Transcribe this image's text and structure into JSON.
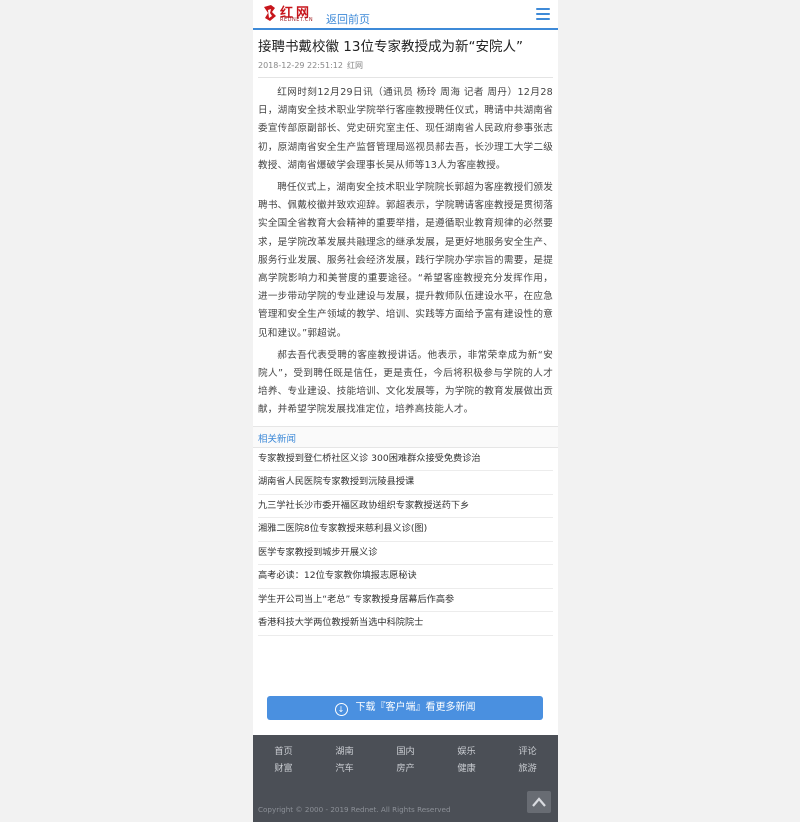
{
  "header": {
    "logo_text": "红网",
    "logo_sub": "REDNET.CN",
    "back_label": "返回前页"
  },
  "article": {
    "title": "接聘书戴校徽 13位专家教授成为新“安院人”",
    "date": "2018-12-29 22:51:12",
    "source": "红网",
    "paragraphs": [
      "红网时刻12月29日讯（通讯员 杨玲 周海 记者 周丹）12月28日，湖南安全技术职业学院举行客座教授聘任仪式，聘请中共湖南省委宣传部原副部长、党史研究室主任、现任湖南省人民政府参事张志初，原湖南省安全生产监督管理局巡视员郝去吾，长沙理工大学二级教授、湖南省爆破学会理事长吴从师等13人为客座教授。",
      "聘任仪式上，湖南安全技术职业学院院长郭超为客座教授们颁发聘书、佩戴校徽并致欢迎辞。郭超表示，学院聘请客座教授是贯彻落实全国全省教育大会精神的重要举措，是遵循职业教育规律的必然要求，是学院改革发展共融理念的继承发展，是更好地服务安全生产、服务行业发展、服务社会经济发展，践行学院办学宗旨的需要，是提高学院影响力和美誉度的重要途径。“希望客座教授充分发挥作用，进一步带动学院的专业建设与发展，提升教师队伍建设水平，在应急管理和安全生产领域的教学、培训、实践等方面给予富有建设性的意见和建议。”郭超说。",
      "郝去吾代表受聘的客座教授讲话。他表示，非常荣幸成为新“安院人”，受到聘任既是信任，更是责任，今后将积极参与学院的人才培养、专业建设、技能培训、文化发展等，为学院的教育发展做出贡献，并希望学院发展找准定位，培养高技能人才。"
    ]
  },
  "related": {
    "heading": "相关新闻",
    "items": [
      "专家教授到登仁桥社区义诊 300困难群众接受免费诊治",
      "湖南省人民医院专家教授到沅陵县授课",
      "九三学社长沙市委开福区政协组织专家教授送药下乡",
      "湘雅二医院8位专家教授来慈利县义诊(图)",
      "医学专家教授到城步开展义诊",
      "高考必读：12位专家教你填报志愿秘诀",
      "学生开公司当上“老总” 专家教授身居幕后作高参",
      "香港科技大学两位教授新当选中科院院士"
    ]
  },
  "download_button": {
    "label": "下载『客户端』看更多新闻",
    "icon": "download-icon"
  },
  "footer": {
    "nav": [
      "首页",
      "湖南",
      "国内",
      "娱乐",
      "评论",
      "财富",
      "汽车",
      "房产",
      "健康",
      "旅游"
    ],
    "copyright": "Copyright © 2000 - 2019 Rednet. All Rights Reserved",
    "to_top_icon": "arrow-up-icon"
  },
  "colors": {
    "accent": "#3e8ad8",
    "brand_red": "#c7151b",
    "footer_bg": "#4b4f56",
    "button_bg": "#4a90e0"
  }
}
